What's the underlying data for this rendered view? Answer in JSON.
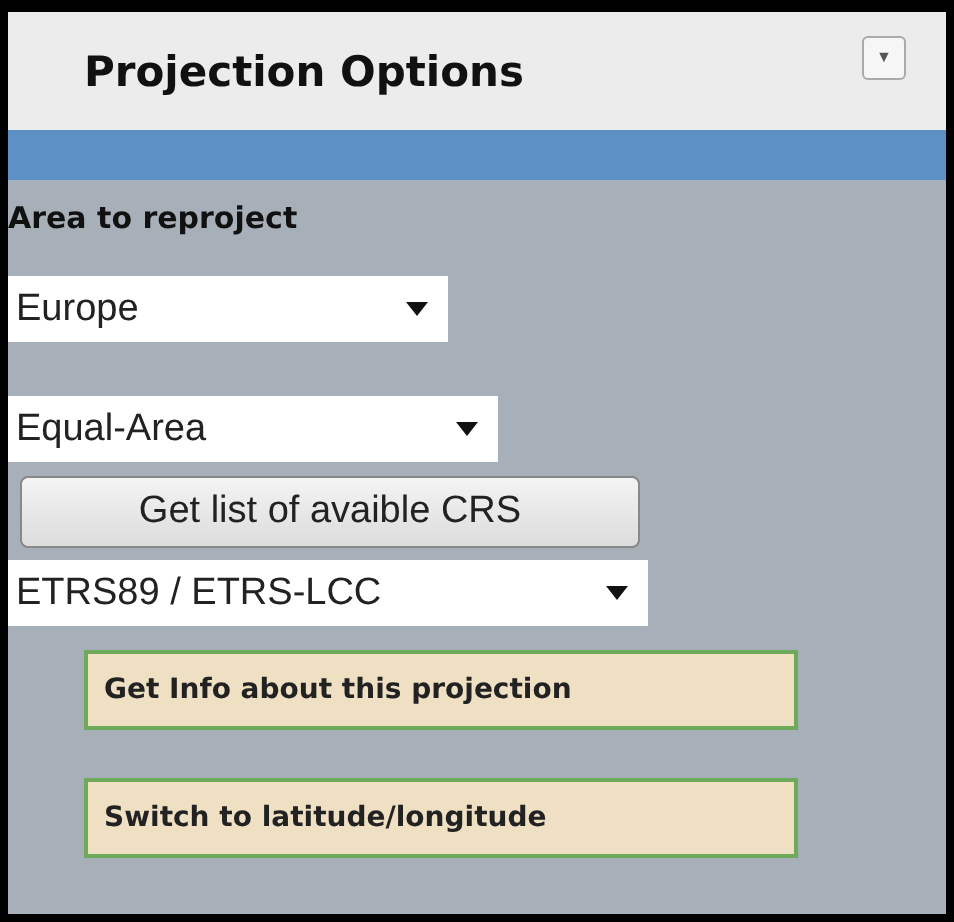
{
  "panel": {
    "title": "Projection Options",
    "collapse_glyph": "▼"
  },
  "section_label": "Area to reproject",
  "selects": [
    {
      "value": "Europe"
    },
    {
      "value": "Equal-Area"
    },
    {
      "value": "ETRS89 / ETRS-LCC"
    }
  ],
  "list_button": "Get list of avaible CRS",
  "action_buttons": [
    "Get Info about this projection",
    "Switch to latitude/longitude"
  ]
}
